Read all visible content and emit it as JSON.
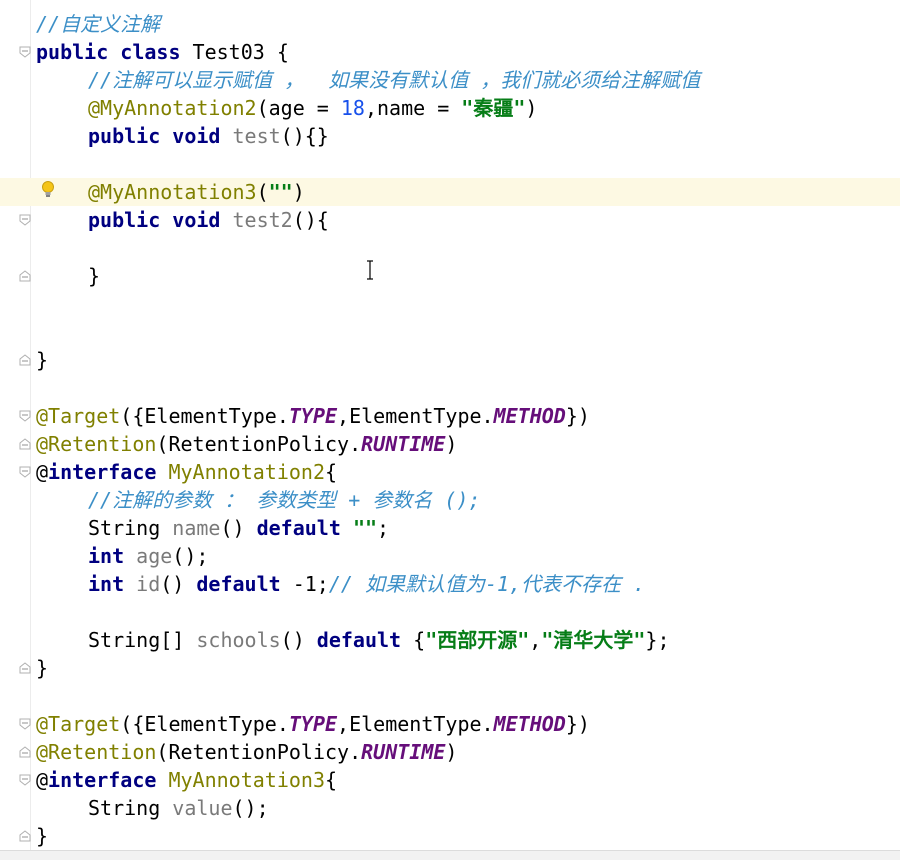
{
  "code": {
    "l1": [
      "//自定义注解"
    ],
    "l2": [
      "public class",
      " Test03 {"
    ],
    "l3": [
      "//注解可以显示赋值 ，  如果没有默认值 ，我们就必须给注解赋值"
    ],
    "l4": [
      "@MyAnnotation2",
      "(age = ",
      "18",
      ",name = ",
      "\"秦疆\"",
      ")"
    ],
    "l5": [
      "public void",
      " ",
      "test",
      "(){}"
    ],
    "l6": [
      "@MyAnnotation3",
      "(",
      "\"\"",
      ")"
    ],
    "l7": [
      "public void",
      " ",
      "test2",
      "(){"
    ],
    "l8": [
      "}"
    ],
    "l9": [
      "}"
    ],
    "l10": [
      "@Target",
      "({ElementType.",
      "TYPE",
      ",ElementType.",
      "METHOD",
      "})"
    ],
    "l11": [
      "@Retention",
      "(RetentionPolicy.",
      "RUNTIME",
      ")"
    ],
    "l12": [
      "@",
      "interface",
      " ",
      "MyAnnotation2",
      "{"
    ],
    "l13": [
      "//注解的参数 ： 参数类型 + 参数名 ();"
    ],
    "l14": [
      "String ",
      "name",
      "() ",
      "default",
      " ",
      "\"\"",
      ";"
    ],
    "l15": [
      "int",
      " ",
      "age",
      "();"
    ],
    "l16": [
      "int",
      " ",
      "id",
      "() ",
      "default",
      " -1;",
      "// 如果默认值为-1,代表不存在 ."
    ],
    "l17": [
      "String[] ",
      "schools",
      "() ",
      "default",
      " {",
      "\"西部开源\"",
      ",",
      "\"清华大学\"",
      "};"
    ],
    "l18": [
      "}"
    ],
    "l19": [
      "@Target",
      "({ElementType.",
      "TYPE",
      ",ElementType.",
      "METHOD",
      "})"
    ],
    "l20": [
      "@Retention",
      "(RetentionPolicy.",
      "RUNTIME",
      ")"
    ],
    "l21": [
      "@",
      "interface",
      " ",
      "MyAnnotation3",
      "{"
    ],
    "l22": [
      "String ",
      "value",
      "();"
    ],
    "l23": [
      "}"
    ]
  },
  "colors": {
    "comment": "#3c8fc7",
    "keyword": "#000080",
    "annotation": "#808000",
    "number": "#1750eb",
    "string": "#067d17",
    "static_field": "#660e7a",
    "highlight_line": "#fdf9e3"
  },
  "icons": [
    "intention-bulb-icon",
    "fold-marker-icon",
    "text-cursor-icon"
  ]
}
